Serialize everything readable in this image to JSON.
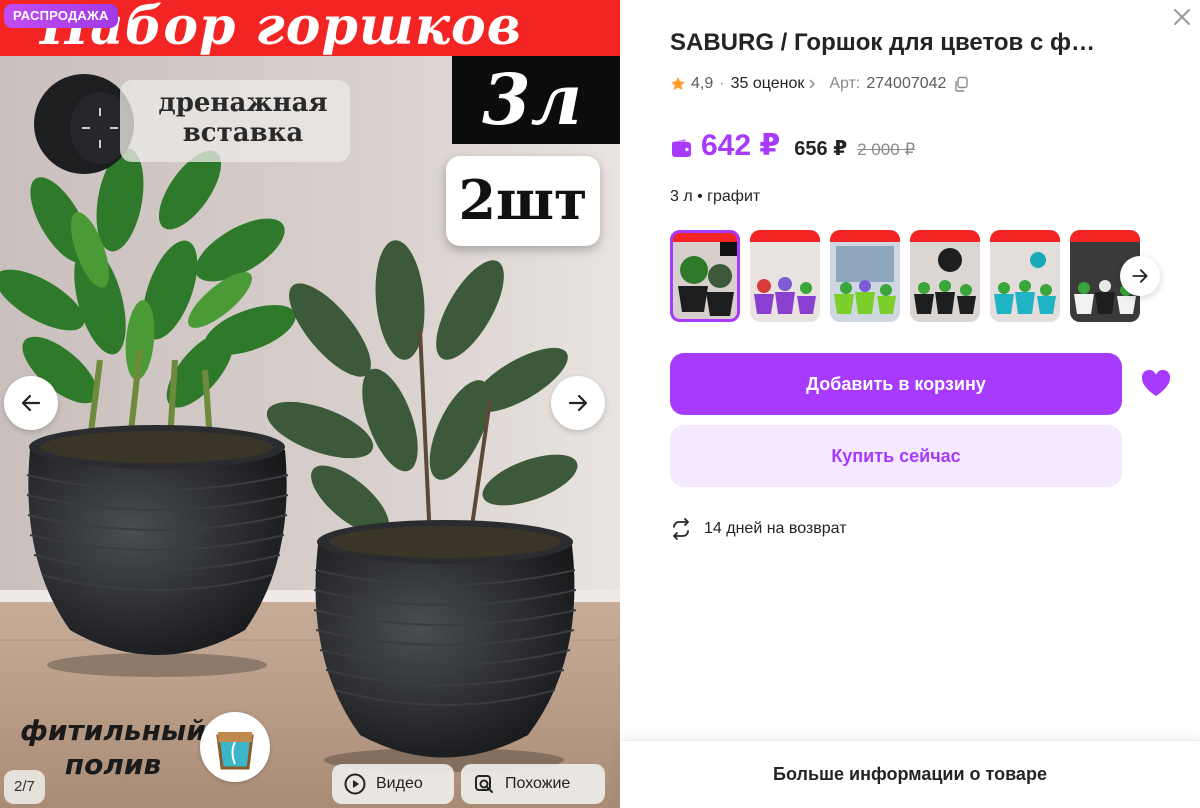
{
  "gallery": {
    "sale_badge": "РАСПРОДАЖА",
    "image_title": "Набор горшков",
    "volume_tag": "3л",
    "quantity_tag": "2шт",
    "drain_text": "дренажная\nвставка",
    "wick_text": "фитильный\nполив",
    "counter": "2/7",
    "video_label": "Видео",
    "similar_label": "Похожие"
  },
  "product": {
    "title": "SABURG / Горшок для цветов с ф…",
    "rating": "4,9",
    "reviews": "35 оценок",
    "article_label": "Арт:",
    "article": "274007042",
    "price_current": "642 ₽",
    "price_old": "656 ₽",
    "price_base": "2 000 ₽",
    "variant": "3 л • графит",
    "thumbs_count": 6
  },
  "actions": {
    "add_to_cart": "Добавить в корзину",
    "buy_now": "Купить сейчас",
    "returns": "14 дней на возврат",
    "more_info": "Больше информации о товаре"
  },
  "colors": {
    "accent": "#a73afd",
    "accent_light": "#f4e9fe",
    "star": "#ff9d2e",
    "banner_red": "#f22424"
  }
}
